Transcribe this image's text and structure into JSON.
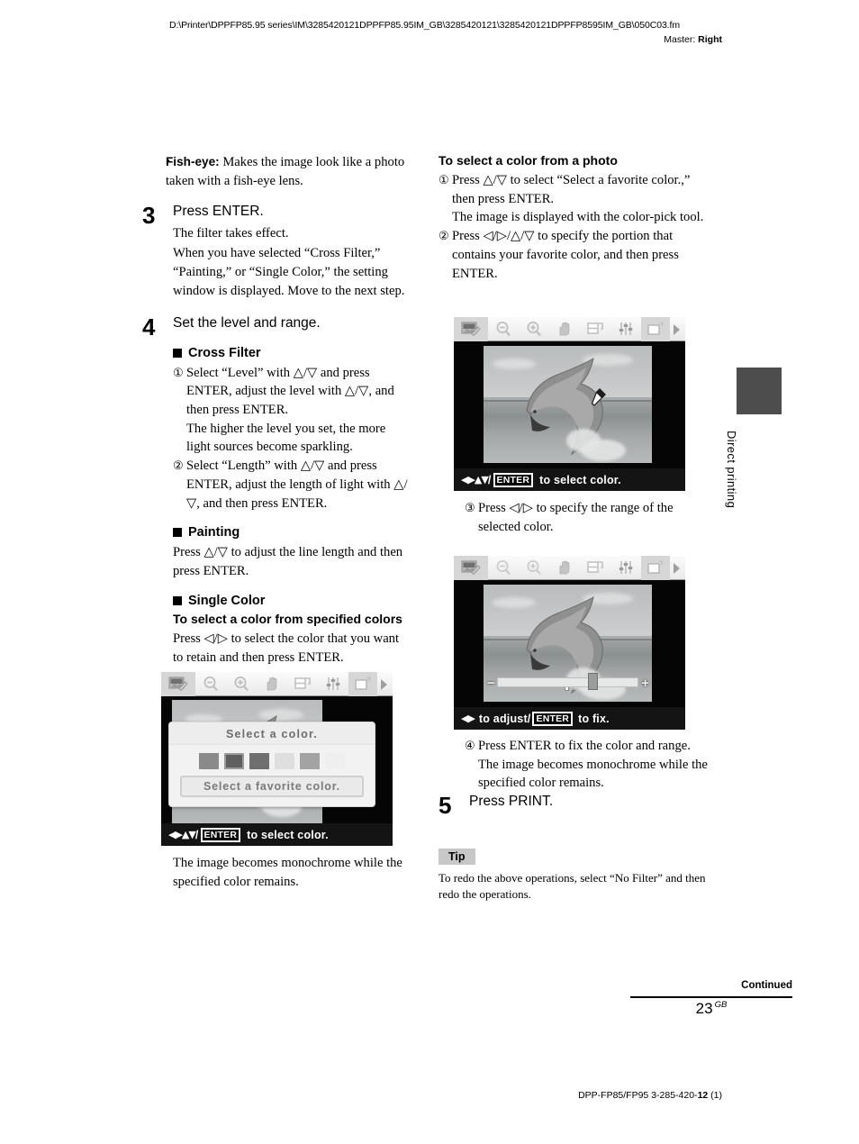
{
  "header": {
    "path": "D:\\Printer\\DPPFP85.95 series\\IM\\3285420121DPPFP85.95IM_GB\\3285420121\\3285420121DPPFP8595IM_GB\\050C03.fm",
    "master_label": "Master:",
    "master_value": "Right"
  },
  "left_column": {
    "bullet": {
      "marker": "•",
      "term": "Fish-eye:",
      "text": " Makes the image look like a photo taken with a fish-eye lens."
    },
    "step3": {
      "number": "3",
      "title": "Press ENTER.",
      "p1": "The filter takes effect.",
      "p2": "When you have selected “Cross Filter,” “Painting,” or “Single Color,” the setting window is displayed. Move to the next step."
    },
    "step4": {
      "number": "4",
      "title": "Set the level and range.",
      "cross_filter_head": "Cross Filter",
      "cf_item1_mark": "①",
      "cf_item1": "Select “Level” with △/▽ and press ENTER, adjust the level with △/▽, and then press ENTER.",
      "cf_item1_sub": "The higher the level you set, the more light sources become sparkling.",
      "cf_item2_mark": "②",
      "cf_item2": "Select “Length” with △/▽ and press ENTER, adjust the length of light with △/▽, and then press ENTER.",
      "painting_head": "Painting",
      "painting_body": "Press △/▽ to adjust the line length and then press ENTER.",
      "single_color_head": "Single Color",
      "single_color_sub": "To select a color from specified colors",
      "single_color_body": "Press ◁/▷ to select the color that you want to retain and then press ENTER.",
      "after_shot_text": "The image becomes monochrome while the specified color remains."
    }
  },
  "right_column": {
    "heading": "To select a color from a photo",
    "item1_mark": "①",
    "item1": "Press △/▽ to select “Select a favorite color.,” then press ENTER.",
    "item1_sub": "The image is displayed with the color-pick tool.",
    "item2_mark": "②",
    "item2": "Press ◁/▷/△/▽ to specify the portion that contains your favorite color, and then press ENTER.",
    "item3_mark": "③",
    "item3": "Press ◁/▷ to specify the range of the selected color.",
    "item4_mark": "④",
    "item4": "Press ENTER to fix the color and range.",
    "item4_sub": "The image becomes monochrome while the specified color remains.",
    "step5": {
      "number": "5",
      "title": "Press PRINT."
    },
    "tip": {
      "label": "Tip",
      "body": "To redo the above operations, select “No Filter” and then redo the operations."
    }
  },
  "lcd_left": {
    "toolbar_icons": [
      "image-edit-icon",
      "zoom-out-icon",
      "zoom-in-icon",
      "hand-pan-icon",
      "crop-icon",
      "adjust-sliders-icon",
      "export-icon",
      "next-arrow-icon"
    ],
    "dialog_title": "Select a color.",
    "swatches": [
      "#8a8a8a",
      "#5f5f5f",
      "#6f6f6f",
      "#dedede",
      "#a3a3a3",
      "#efefef"
    ],
    "selected_swatch_index": 1,
    "favorite_button": "Select a favorite color.",
    "status_dpad": "◀▶▲▼",
    "status_slash": "/",
    "status_key": "ENTER",
    "status_text": "to select color."
  },
  "lcd_right_1": {
    "status_dpad": "◀▶▲▼",
    "status_slash": "/",
    "status_key": "ENTER",
    "status_text": "to select color.",
    "tool_overlay": "eyedropper-icon"
  },
  "lcd_right_2": {
    "status_dpad": "◀▶",
    "status_text_pre": "to adjust/",
    "status_key": "ENTER",
    "status_text_post": "to fix.",
    "range_minus": "−",
    "range_plus": "+"
  },
  "side_tab": {
    "label": "Direct printing"
  },
  "footer": {
    "continued": "Continued",
    "page_number": "23",
    "page_suffix": "GB",
    "model_pre": "DPP-FP85/FP95 3-285-420-",
    "model_bold": "12",
    "model_post": " (1)"
  }
}
